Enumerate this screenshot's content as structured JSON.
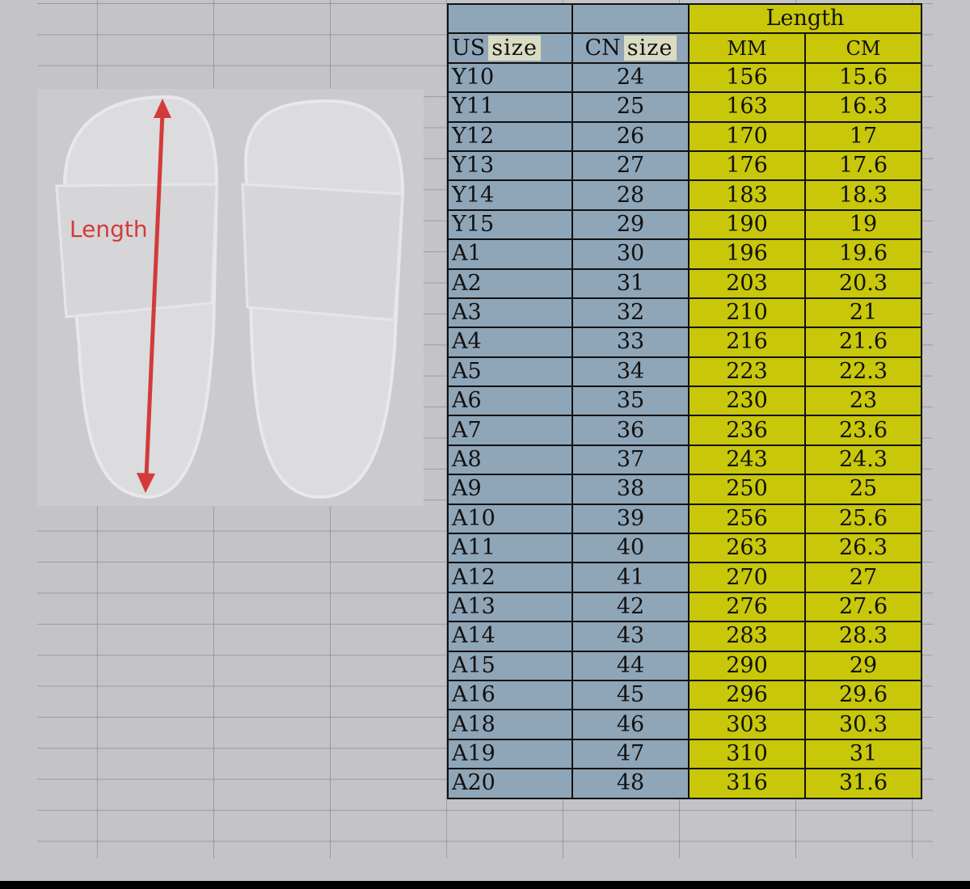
{
  "illustration": {
    "length_label": "Length"
  },
  "colors": {
    "size_columns": "#8fa5b8",
    "length_columns": "#c8c70a",
    "arrow": "#d43a3a"
  },
  "table": {
    "group_header": "Length",
    "headers": {
      "us_prefix": "US",
      "us_suffix": "size",
      "cn_prefix": "CN",
      "cn_suffix": "size",
      "mm": "MM",
      "cm": "CM"
    },
    "rows": [
      {
        "us": "Y10",
        "cn": "24",
        "mm": "156",
        "cm": "15.6"
      },
      {
        "us": "Y11",
        "cn": "25",
        "mm": "163",
        "cm": "16.3"
      },
      {
        "us": "Y12",
        "cn": "26",
        "mm": "170",
        "cm": "17"
      },
      {
        "us": "Y13",
        "cn": "27",
        "mm": "176",
        "cm": "17.6"
      },
      {
        "us": "Y14",
        "cn": "28",
        "mm": "183",
        "cm": "18.3"
      },
      {
        "us": "Y15",
        "cn": "29",
        "mm": "190",
        "cm": "19"
      },
      {
        "us": "A1",
        "cn": "30",
        "mm": "196",
        "cm": "19.6"
      },
      {
        "us": "A2",
        "cn": "31",
        "mm": "203",
        "cm": "20.3"
      },
      {
        "us": "A3",
        "cn": "32",
        "mm": "210",
        "cm": "21"
      },
      {
        "us": "A4",
        "cn": "33",
        "mm": "216",
        "cm": "21.6"
      },
      {
        "us": "A5",
        "cn": "34",
        "mm": "223",
        "cm": "22.3"
      },
      {
        "us": "A6",
        "cn": "35",
        "mm": "230",
        "cm": "23"
      },
      {
        "us": "A7",
        "cn": "36",
        "mm": "236",
        "cm": "23.6"
      },
      {
        "us": "A8",
        "cn": "37",
        "mm": "243",
        "cm": "24.3"
      },
      {
        "us": "A9",
        "cn": "38",
        "mm": "250",
        "cm": "25"
      },
      {
        "us": "A10",
        "cn": "39",
        "mm": "256",
        "cm": "25.6"
      },
      {
        "us": "A11",
        "cn": "40",
        "mm": "263",
        "cm": "26.3"
      },
      {
        "us": "A12",
        "cn": "41",
        "mm": "270",
        "cm": "27"
      },
      {
        "us": "A13",
        "cn": "42",
        "mm": "276",
        "cm": "27.6"
      },
      {
        "us": "A14",
        "cn": "43",
        "mm": "283",
        "cm": "28.3"
      },
      {
        "us": "A15",
        "cn": "44",
        "mm": "290",
        "cm": "29"
      },
      {
        "us": "A16",
        "cn": "45",
        "mm": "296",
        "cm": "29.6"
      },
      {
        "us": "A18",
        "cn": "46",
        "mm": "303",
        "cm": "30.3"
      },
      {
        "us": "A19",
        "cn": "47",
        "mm": "310",
        "cm": "31"
      },
      {
        "us": "A20",
        "cn": "48",
        "mm": "316",
        "cm": "31.6"
      }
    ]
  }
}
